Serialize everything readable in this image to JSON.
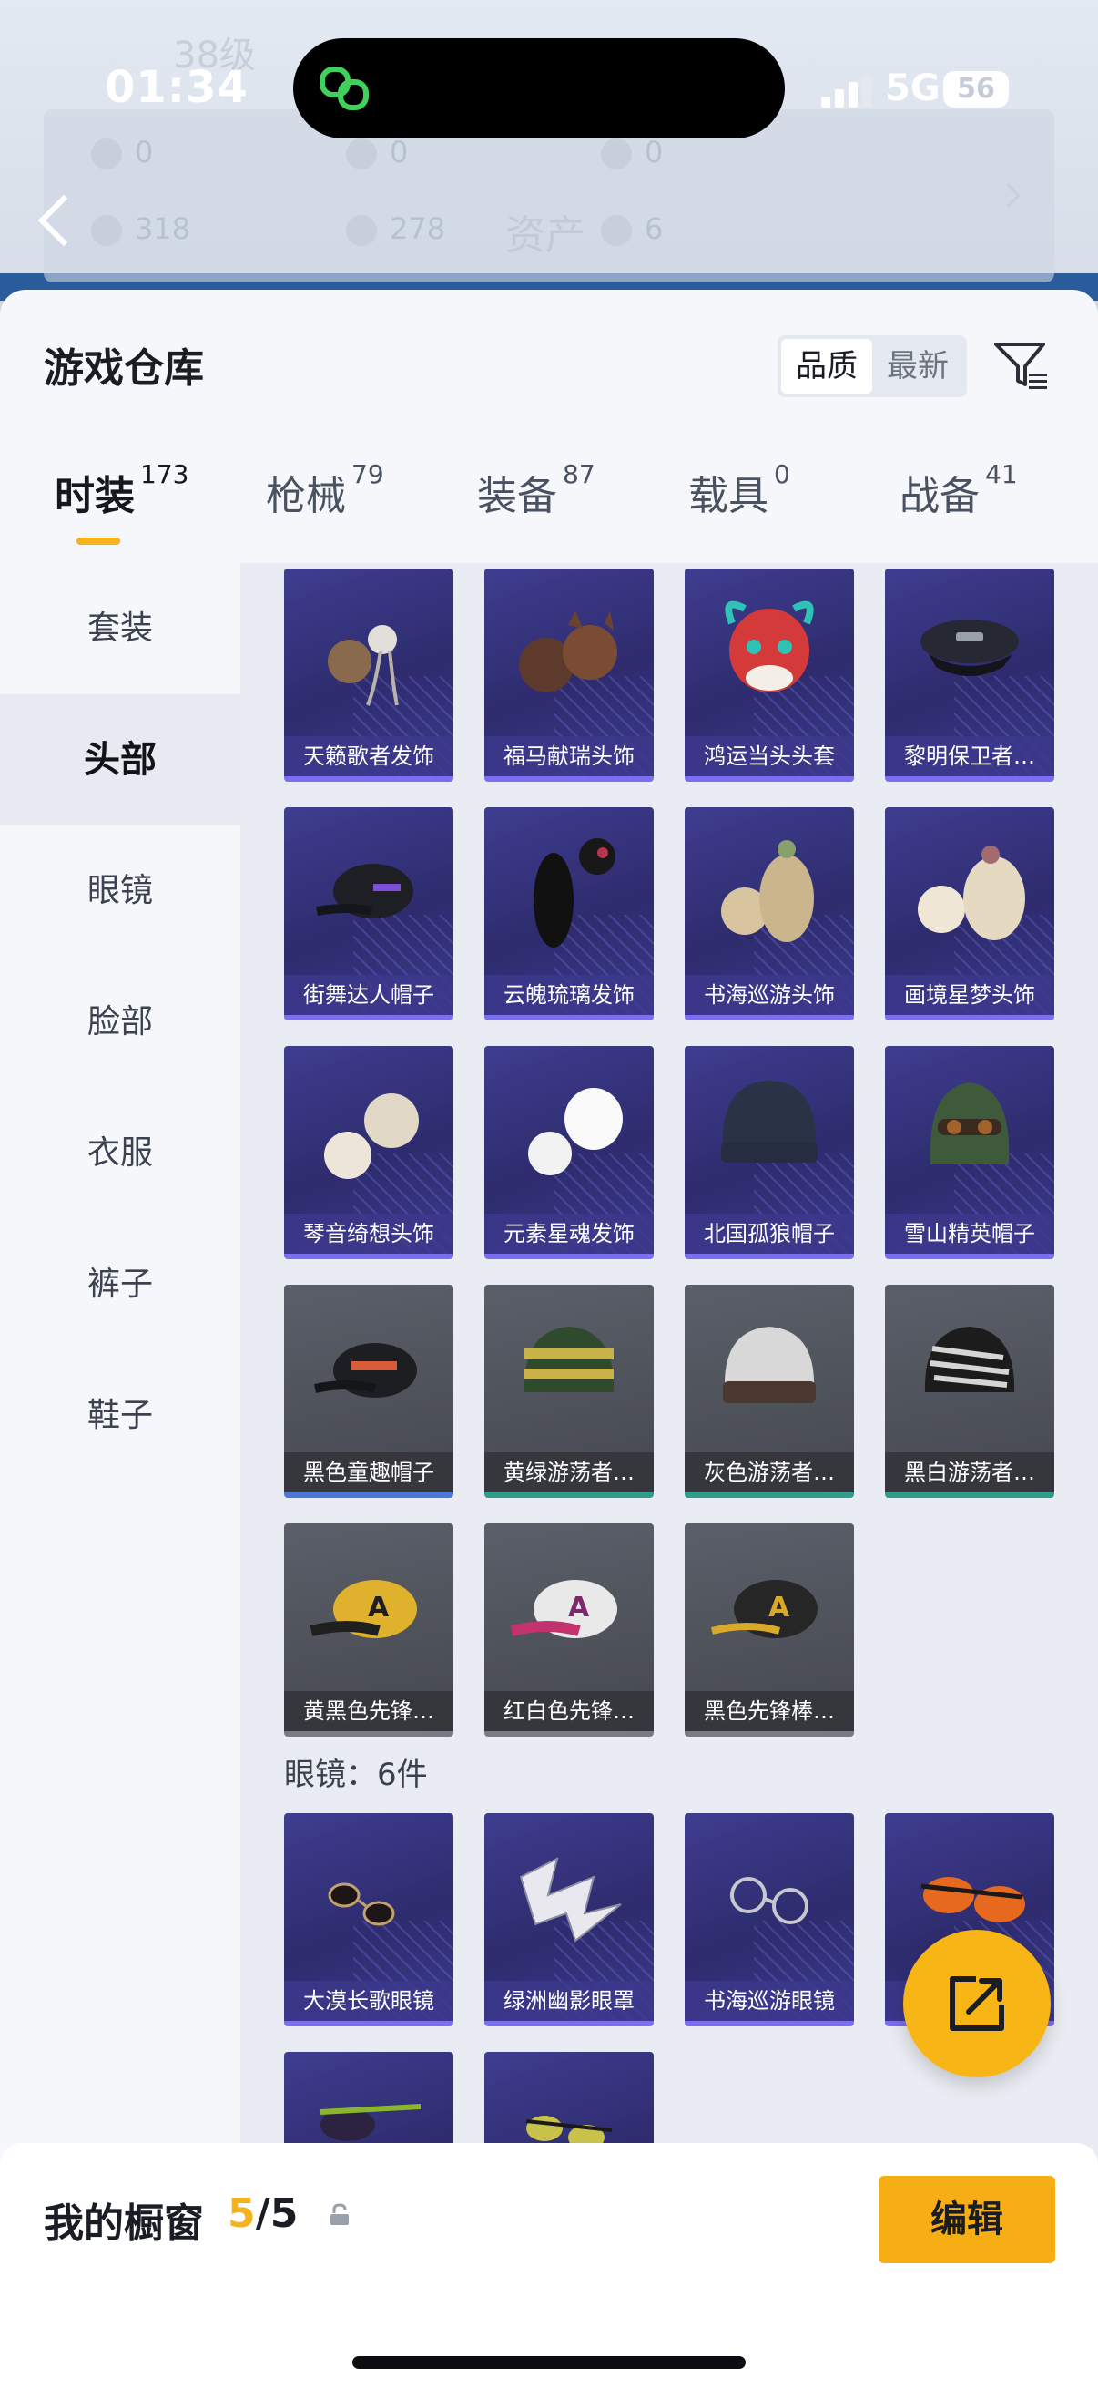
{
  "status_bar": {
    "time": "01:34",
    "network": "5G",
    "battery": "56"
  },
  "background_header": {
    "level": "38级",
    "title": "资产",
    "stats_row1": [
      "0",
      "0",
      "0"
    ],
    "stats_row2": [
      "318",
      "278",
      "6"
    ]
  },
  "sheet": {
    "title": "游戏仓库",
    "sort": {
      "quality": "品质",
      "newest": "最新"
    }
  },
  "tabs": [
    {
      "label": "时装",
      "count": "173"
    },
    {
      "label": "枪械",
      "count": "79"
    },
    {
      "label": "装备",
      "count": "87"
    },
    {
      "label": "载具",
      "count": "0"
    },
    {
      "label": "战备",
      "count": "41"
    }
  ],
  "sidebar": {
    "items": [
      "套装",
      "头部",
      "眼镜",
      "脸部",
      "衣服",
      "裤子",
      "鞋子"
    ]
  },
  "head_items": [
    "天籁歌者发饰",
    "福马献瑞头饰",
    "鸿运当头头套",
    "黎明保卫者…",
    "街舞达人帽子",
    "云魄琉璃发饰",
    "书海巡游头饰",
    "画境星梦头饰",
    "琴音绮想头饰",
    "元素星魂发饰",
    "北国孤狼帽子",
    "雪山精英帽子",
    "黑色童趣帽子",
    "黄绿游荡者…",
    "灰色游荡者…",
    "黑白游荡者…",
    "黄黑色先锋…",
    "红白色先锋…",
    "黑色先锋棒…"
  ],
  "glasses_section": {
    "label": "眼镜：6件",
    "items": [
      "大漠长歌眼镜",
      "绿洲幽影眼罩",
      "书海巡游眼镜",
      "",
      "",
      ""
    ]
  },
  "bottom_bar": {
    "label": "我的橱窗",
    "count_current": "5",
    "count_sep_total": "/5",
    "edit": "编辑"
  },
  "colors": {
    "accent": "#f5b21b",
    "purple_card": "#34327a",
    "grey_card": "#505359"
  },
  "icons": [
    "back-arrow-icon",
    "link-icon",
    "filter-icon",
    "lock-icon",
    "share-icon"
  ]
}
